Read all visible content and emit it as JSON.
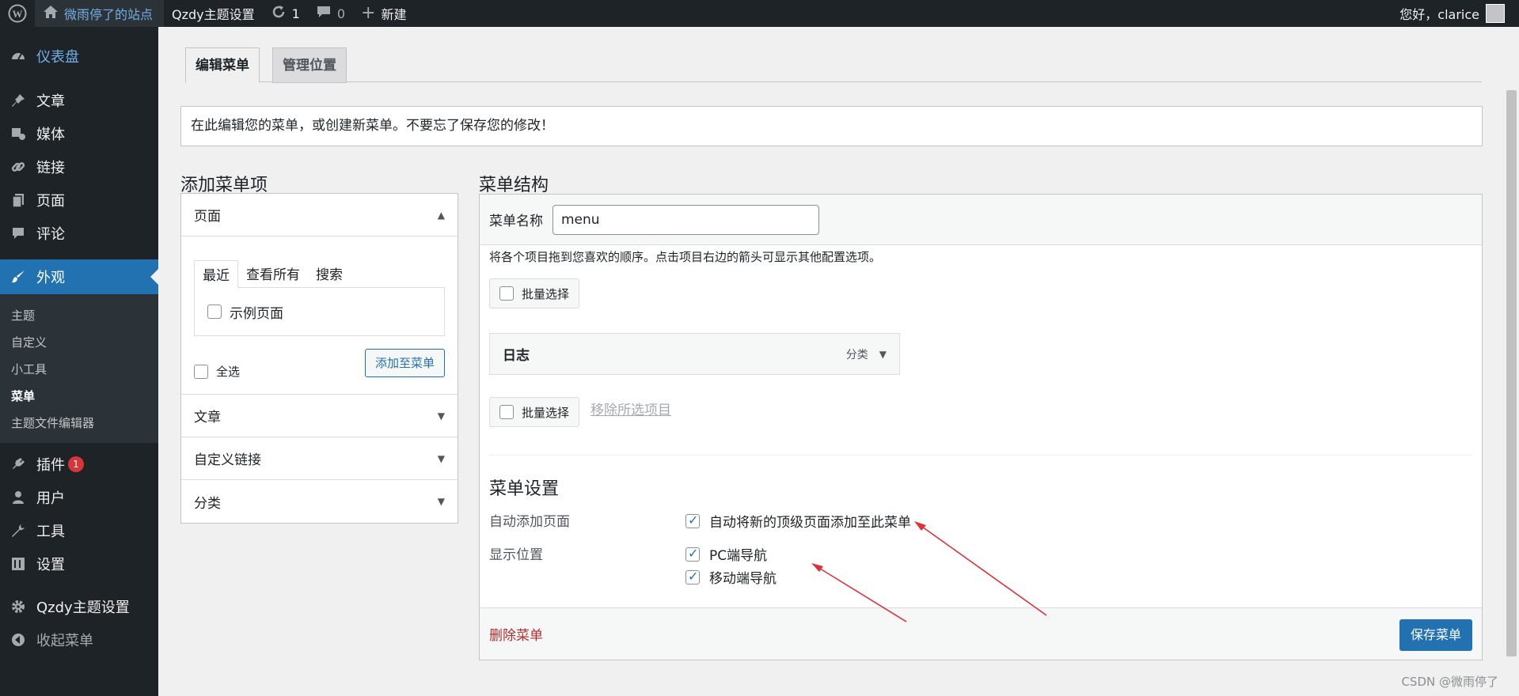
{
  "adminbar": {
    "site_name": "微雨停了的站点",
    "theme_settings": "Qzdy主题设置",
    "updates_count": "1",
    "comments_count": "0",
    "new_label": "新建",
    "greeting": "您好，clarice"
  },
  "sidebar": {
    "items": [
      {
        "label": "仪表盘",
        "icon": "dashboard-icon"
      },
      {
        "label": "文章",
        "icon": "pin-icon"
      },
      {
        "label": "媒体",
        "icon": "media-icon"
      },
      {
        "label": "链接",
        "icon": "link-icon"
      },
      {
        "label": "页面",
        "icon": "page-icon"
      },
      {
        "label": "评论",
        "icon": "comment-icon"
      },
      {
        "label": "外观",
        "icon": "brush-icon"
      },
      {
        "label": "插件",
        "icon": "plugin-icon"
      },
      {
        "label": "用户",
        "icon": "user-icon"
      },
      {
        "label": "工具",
        "icon": "wrench-icon"
      },
      {
        "label": "设置",
        "icon": "settings-icon"
      },
      {
        "label": "Qzdy主题设置",
        "icon": "gear-icon"
      },
      {
        "label": "收起菜单",
        "icon": "collapse-icon"
      }
    ],
    "submenu": [
      "主题",
      "自定义",
      "小工具",
      "菜单",
      "主题文件编辑器"
    ],
    "plugins_badge": "1"
  },
  "tabs": {
    "edit_menus": "编辑菜单",
    "manage_locations": "管理位置"
  },
  "notice": "在此编辑您的菜单，或创建新菜单。不要忘了保存您的修改！",
  "add_items": {
    "title": "添加菜单项",
    "pages_title": "页面",
    "tabs": [
      "最近",
      "查看所有",
      "搜索"
    ],
    "sample_page": "示例页面",
    "select_all": "全选",
    "add_button": "添加至菜单",
    "sections": [
      "文章",
      "自定义链接",
      "分类"
    ]
  },
  "structure": {
    "title": "菜单结构",
    "name_label": "菜单名称",
    "name_value": "menu",
    "instructions": "将各个项目拖到您喜欢的顺序。点击项目右边的箭头可显示其他配置选项。",
    "bulk_select": "批量选择",
    "item_title": "日志",
    "item_type": "分类",
    "remove_selected": "移除所选项目",
    "settings_title": "菜单设置",
    "auto_add_label": "自动添加页面",
    "auto_add_option": "自动将新的顶级页面添加至此菜单",
    "display_location_label": "显示位置",
    "locations": [
      "PC端导航",
      "移动端导航"
    ],
    "delete_menu": "删除菜单",
    "save_menu": "保存菜单"
  },
  "watermark": "CSDN @微雨停了"
}
